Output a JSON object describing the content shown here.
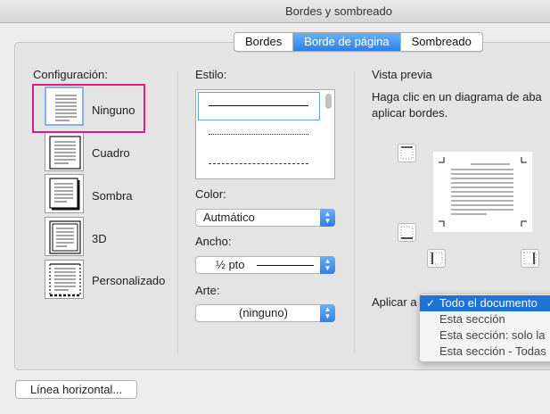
{
  "window": {
    "title": "Bordes y sombreado"
  },
  "tabs": [
    "Bordes",
    "Borde de página",
    "Sombreado"
  ],
  "active_tab": "Borde de página",
  "settings": {
    "heading": "Configuración:",
    "selected": "Ninguno",
    "items": [
      {
        "label": "Ninguno",
        "icon": "page-no-border-icon"
      },
      {
        "label": "Cuadro",
        "icon": "page-box-border-icon"
      },
      {
        "label": "Sombra",
        "icon": "page-shadow-border-icon"
      },
      {
        "label": "3D",
        "icon": "page-3d-border-icon"
      },
      {
        "label": "Personalizado",
        "icon": "page-custom-border-icon"
      }
    ]
  },
  "style": {
    "heading": "Estilo:"
  },
  "color": {
    "label": "Color:",
    "value": "Autmático"
  },
  "width": {
    "label": "Ancho:",
    "value": "½ pto"
  },
  "art": {
    "label": "Arte:",
    "value": "(ninguno)"
  },
  "preview": {
    "heading": "Vista previa",
    "instructions_line1": "Haga clic en un diagrama de aba",
    "instructions_line2": "aplicar bordes."
  },
  "apply_to": {
    "label": "Aplicar a",
    "options": [
      "Todo el documento",
      "Esta sección",
      "Esta sección: solo la",
      "Esta sección - Todas"
    ],
    "selected": "Todo el documento"
  },
  "horizontal_line_button": "Línea horizontal...",
  "colors": {
    "accent": "#2e7fe6",
    "highlight": "#e0198a",
    "menu_selected": "#1f72d8"
  }
}
